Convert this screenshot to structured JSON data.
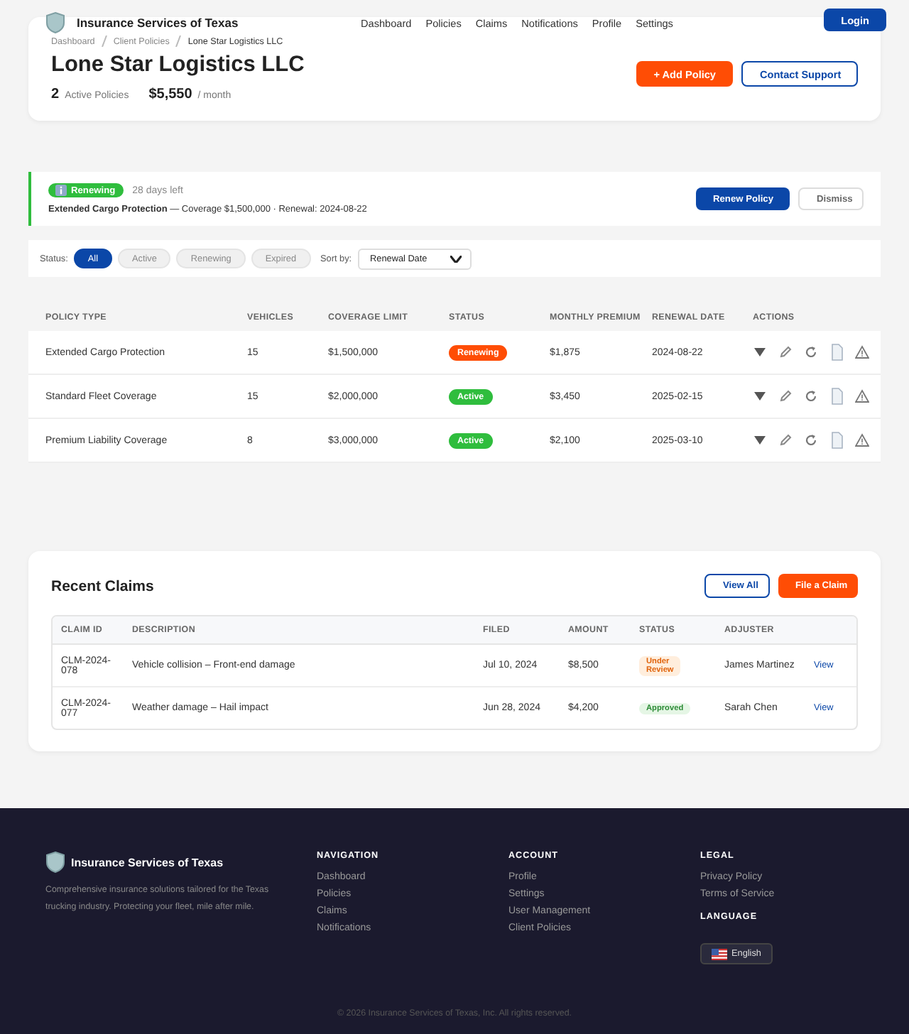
{
  "header": {
    "brand": "Insurance Services of Texas",
    "nav": [
      "Dashboard",
      "Policies",
      "Claims",
      "Notifications",
      "Profile",
      "Settings"
    ],
    "login": "Login"
  },
  "breadcrumb": [
    "Dashboard",
    "Client Policies",
    "Lone Star Logistics LLC"
  ],
  "client": {
    "name": "Lone Star Logistics LLC",
    "stats": [
      {
        "value": "2",
        "label": "Active Policies"
      },
      {
        "value": "$5,550",
        "label": "/ month"
      }
    ],
    "buttons": [
      "+ Add Policy",
      "Contact Support"
    ]
  },
  "alert": {
    "badge": "Renewing",
    "days_left": "28 days left",
    "message": "**Extended Cargo Protection** — Coverage $1,500,000 · Renewal: 2024-08-22",
    "buttons": [
      "Renew Policy",
      "Dismiss"
    ]
  },
  "filters": {
    "label": "Status:",
    "chips": [
      {
        "label": "All",
        "selected": true
      },
      {
        "label": "Active",
        "selected": false
      },
      {
        "label": "Renewing",
        "selected": false
      },
      {
        "label": "Expired",
        "selected": false
      }
    ],
    "sort_label": "Sort by:",
    "sort_value": "Renewal Date"
  },
  "policies": {
    "columns": [
      "POLICY TYPE",
      "VEHICLES",
      "COVERAGE LIMIT",
      "STATUS",
      "MONTHLY PREMIUM",
      "RENEWAL DATE",
      "ACTIONS"
    ],
    "rows": [
      {
        "type": "Extended Cargo Protection",
        "vehicles": "15",
        "limit": "$1,500,000",
        "status": "Renewing",
        "kind": "renewing",
        "premium": "$1,875",
        "renewal": "2024-08-22"
      },
      {
        "type": "Standard Fleet Coverage",
        "vehicles": "15",
        "limit": "$2,000,000",
        "status": "Active",
        "kind": "active",
        "premium": "$3,450",
        "renewal": "2025-02-15"
      },
      {
        "type": "Premium Liability Coverage",
        "vehicles": "8",
        "limit": "$3,000,000",
        "status": "Active",
        "kind": "active",
        "premium": "$2,100",
        "renewal": "2025-03-10"
      }
    ]
  },
  "claims": {
    "title": "Recent Claims",
    "buttons": [
      "View All",
      "File a Claim"
    ],
    "columns": [
      "CLAIM ID",
      "DESCRIPTION",
      "FILED",
      "AMOUNT",
      "STATUS",
      "ADJUSTER"
    ],
    "rows": [
      {
        "id": "CLM-2024-078",
        "description": "Vehicle collision – Front-end damage",
        "filed": "Jul 10, 2024",
        "amount": "$8,500",
        "status": "Under Review",
        "kind": "review",
        "adjuster": "James Martinez",
        "link": "View"
      },
      {
        "id": "CLM-2024-077",
        "description": "Weather damage – Hail impact",
        "filed": "Jun 28, 2024",
        "amount": "$4,200",
        "status": "Approved",
        "kind": "approved",
        "adjuster": "Sarah Chen",
        "link": "View"
      }
    ]
  },
  "footer": {
    "brand": "Insurance Services of Texas",
    "about": "Comprehensive insurance solutions tailored for the Texas trucking industry. Protecting your fleet, mile after mile.",
    "columns": [
      {
        "title": "NAVIGATION",
        "links": [
          "Dashboard",
          "Policies",
          "Claims",
          "Notifications"
        ]
      },
      {
        "title": "ACCOUNT",
        "links": [
          "Profile",
          "Settings",
          "User Management",
          "Client Policies"
        ]
      },
      {
        "title": "LEGAL",
        "links": [
          "Privacy Policy",
          "Terms of Service"
        ]
      }
    ],
    "language_title": "LANGUAGE",
    "language": "English",
    "copyright": "© 2026 Insurance Services of Texas, Inc. All rights reserved."
  }
}
